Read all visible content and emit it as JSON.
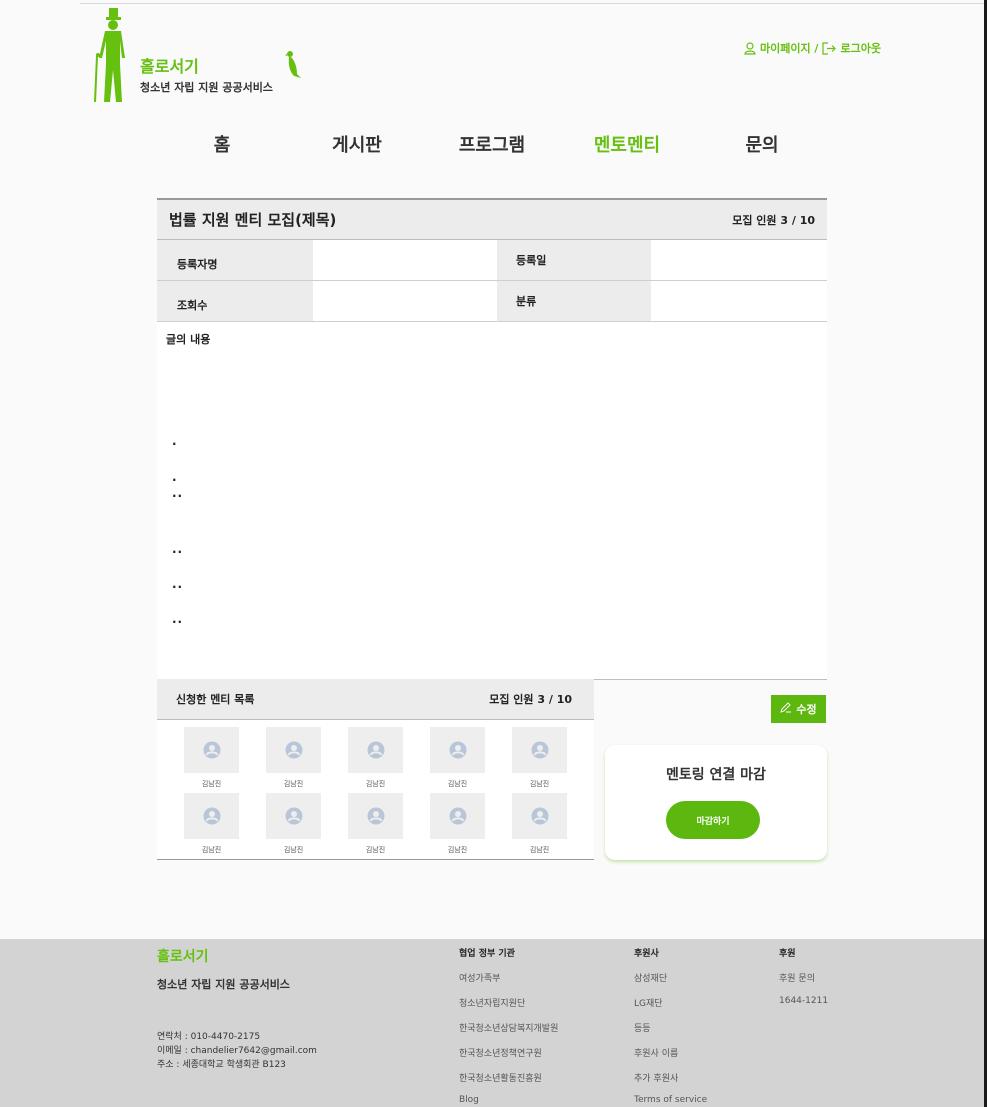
{
  "brand": {
    "title": "홀로서기",
    "subtitle": "청소년 자립 지원 공공서비스"
  },
  "top_links": {
    "mypage": "마이페이지 /",
    "logout": "로그아웃"
  },
  "nav": [
    {
      "label": "홈",
      "active": false
    },
    {
      "label": "게시판",
      "active": false
    },
    {
      "label": "프로그램",
      "active": false
    },
    {
      "label": "멘토멘티",
      "active": true
    },
    {
      "label": "문의",
      "active": false
    }
  ],
  "post": {
    "title": "법률 지원 멘티 모집(제목)",
    "count": "모집 인원 3 / 10",
    "fields": {
      "author_label": "등록자명",
      "date_label": "등록일",
      "views_label": "조회수",
      "category_label": "분류"
    },
    "content_label": "글의 내용",
    "content_lines": [
      ".",
      ".",
      "..",
      "..",
      "..",
      ".."
    ]
  },
  "mentees": {
    "title": "신청한 멘티 목록",
    "count": "모집 인원 3 / 10",
    "names": [
      "김남진",
      "김남진",
      "김남진",
      "김남진",
      "김남진",
      "김남진",
      "김남진",
      "김남진",
      "김남진",
      "김남진"
    ]
  },
  "edit_label": "수정",
  "closing": {
    "title": "멘토링 연결 마감",
    "button": "마감하기"
  },
  "footer": {
    "brand": "홀로서기",
    "subtitle": "청소년 자립 지원 공공서비스",
    "contact": [
      "연락처 : 010-4470-2175",
      "이메일 : chandelier7642@gmail.com",
      "주소 : 세종대학교 학생회관 B123"
    ],
    "col1": {
      "title": "협업 정부 기관",
      "links": [
        "여성가족부",
        "청소년자립지원단",
        "한국청소년상담복지개발원",
        "한국청소년정책연구원",
        "한국청소년활동진흥원",
        "Blog"
      ]
    },
    "col2": {
      "title": "후원사",
      "links": [
        "삼성재단",
        "LG재단",
        "등등",
        "후원사 이름",
        "추가 후원사",
        "Terms of service"
      ]
    },
    "col3": {
      "title": "후원",
      "links": [
        "후원 문의",
        "1644-1211"
      ]
    }
  },
  "colors": {
    "accent": "#66c010",
    "button": "#5cb80e",
    "header_bg": "#ececec",
    "footer_bg": "#d3d3d3"
  },
  "icons": [
    "gentleman-logo-icon",
    "bird-icon",
    "user-icon",
    "logout-icon",
    "pencil-icon",
    "avatar-icon"
  ]
}
